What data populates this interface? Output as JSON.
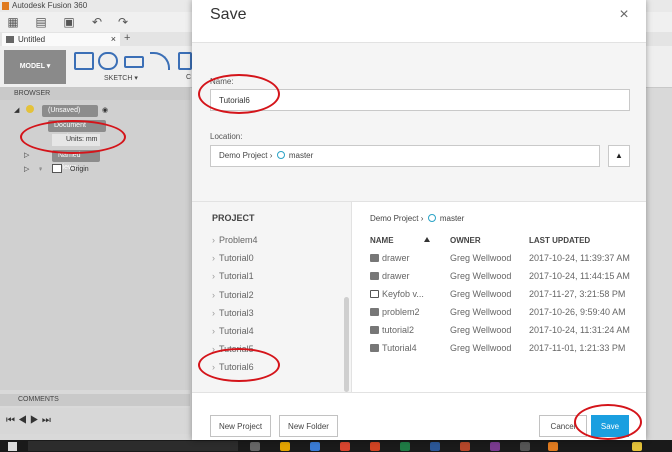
{
  "app": {
    "title": "Autodesk Fusion 360",
    "doc_tab": "Untitled",
    "doc_tab_close": "×",
    "new_tab": "+",
    "workspace": "MODEL ▾",
    "sketch_label": "SKETCH ▾",
    "ribbon_cut": "C",
    "browser_label": "BROWSER",
    "tree": {
      "root": "(Unsaved)",
      "document_settings": "Document Setting",
      "units": "Units: mm",
      "named_views": "Named Views",
      "origin": "Origin"
    },
    "comments_label": "COMMENTS"
  },
  "dialog": {
    "title": "Save",
    "name_label": "Name:",
    "name_value": "Tutorial6",
    "location_label": "Location:",
    "location_project": "Demo Project",
    "location_sep": "›",
    "location_folder": "master",
    "location_toggle": "▲",
    "project_header": "PROJECT",
    "projects": [
      "Problem4",
      "Tutorial0",
      "Tutorial1",
      "Tutorial2",
      "Tutorial3",
      "Tutorial4",
      "Tutorial5",
      "Tutorial6"
    ],
    "project_chevron": "›",
    "breadcrumb_project": "Demo Project",
    "breadcrumb_sep": "›",
    "breadcrumb_folder": "master",
    "columns": {
      "name": "NAME",
      "owner": "OWNER",
      "updated": "LAST UPDATED"
    },
    "files": [
      {
        "name": "drawer",
        "owner": "Greg Wellwood",
        "updated": "2017-10-24, 11:39:37 AM",
        "icon": "component-icon"
      },
      {
        "name": "drawer",
        "owner": "Greg Wellwood",
        "updated": "2017-10-24, 11:44:15 AM",
        "icon": "component-icon"
      },
      {
        "name": "Keyfob v...",
        "owner": "Greg Wellwood",
        "updated": "2017-11-27, 3:21:58 PM",
        "icon": "image-icon"
      },
      {
        "name": "problem2",
        "owner": "Greg Wellwood",
        "updated": "2017-10-26, 9:59:40 AM",
        "icon": "component-icon"
      },
      {
        "name": "tutorial2",
        "owner": "Greg Wellwood",
        "updated": "2017-10-24, 11:31:24 AM",
        "icon": "component-icon"
      },
      {
        "name": "Tutorial4",
        "owner": "Greg Wellwood",
        "updated": "2017-11-01, 1:21:33 PM",
        "icon": "component-icon"
      }
    ],
    "new_project": "New Project",
    "new_folder": "New Folder",
    "cancel": "Cancel",
    "save": "Save",
    "close": "×"
  },
  "colors": {
    "accent": "#1a9fe0",
    "annotation": "#d4141a",
    "location_circle": "#2ba3c6"
  }
}
